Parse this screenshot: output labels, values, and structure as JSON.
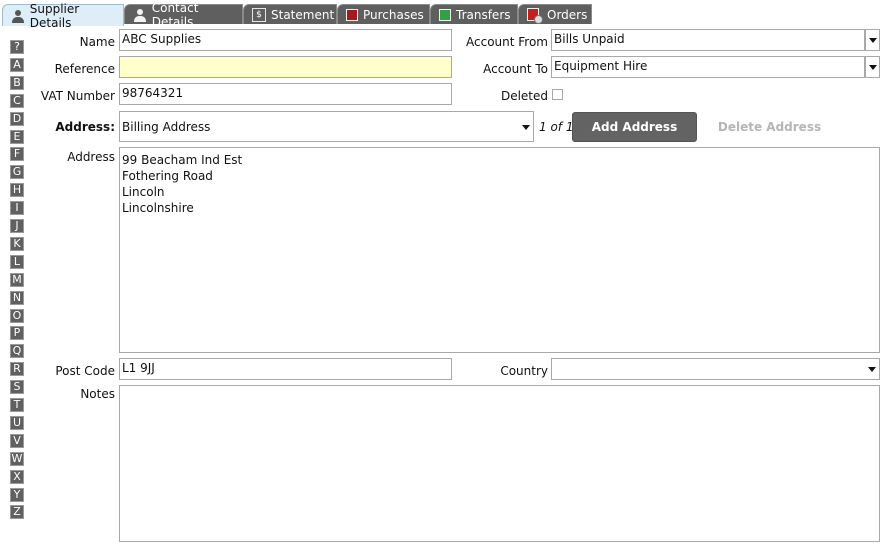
{
  "tabs": [
    {
      "label": "Supplier Details",
      "icon": "person-icon",
      "active": true
    },
    {
      "label": "Contact Details",
      "icon": "person-icon",
      "active": false
    },
    {
      "label": "Statement",
      "icon": "statement-doc-icon",
      "active": false
    },
    {
      "label": "Purchases",
      "icon": "red-square-icon",
      "active": false
    },
    {
      "label": "Transfers",
      "icon": "green-square-icon",
      "active": false
    },
    {
      "label": "Orders",
      "icon": "orders-icon",
      "active": false
    }
  ],
  "alphabet": [
    "?",
    "A",
    "B",
    "C",
    "D",
    "E",
    "F",
    "G",
    "H",
    "I",
    "J",
    "K",
    "L",
    "M",
    "N",
    "O",
    "P",
    "Q",
    "R",
    "S",
    "T",
    "U",
    "V",
    "W",
    "X",
    "Y",
    "Z"
  ],
  "form": {
    "name": {
      "label": "Name",
      "value": "ABC Supplies"
    },
    "reference": {
      "label": "Reference",
      "value": ""
    },
    "vat_number": {
      "label": "VAT Number",
      "value": "98764321"
    },
    "account_from": {
      "label": "Account From",
      "value": "Bills Unpaid"
    },
    "account_to": {
      "label": "Account To",
      "value": "Equipment Hire"
    },
    "deleted": {
      "label": "Deleted",
      "checked": false
    },
    "address_select": {
      "label": "Address:",
      "value": "Billing Address",
      "pager": "1 of 1"
    },
    "add_address_label": "Add Address",
    "delete_address_label": "Delete Address",
    "address": {
      "label": "Address",
      "lines": [
        "99 Beacham Ind Est",
        "Fothering Road",
        "Lincoln",
        "Lincolnshire"
      ]
    },
    "post_code": {
      "label": "Post Code",
      "value": "L1 9JJ"
    },
    "country": {
      "label": "Country",
      "value": ""
    },
    "notes": {
      "label": "Notes",
      "value": ""
    }
  },
  "colors": {
    "tab_active_bg": "#ddeef9",
    "tab_inactive_bg": "#5f5f5f",
    "reference_bg": "#ffffcc",
    "button_dark": "#636363"
  }
}
